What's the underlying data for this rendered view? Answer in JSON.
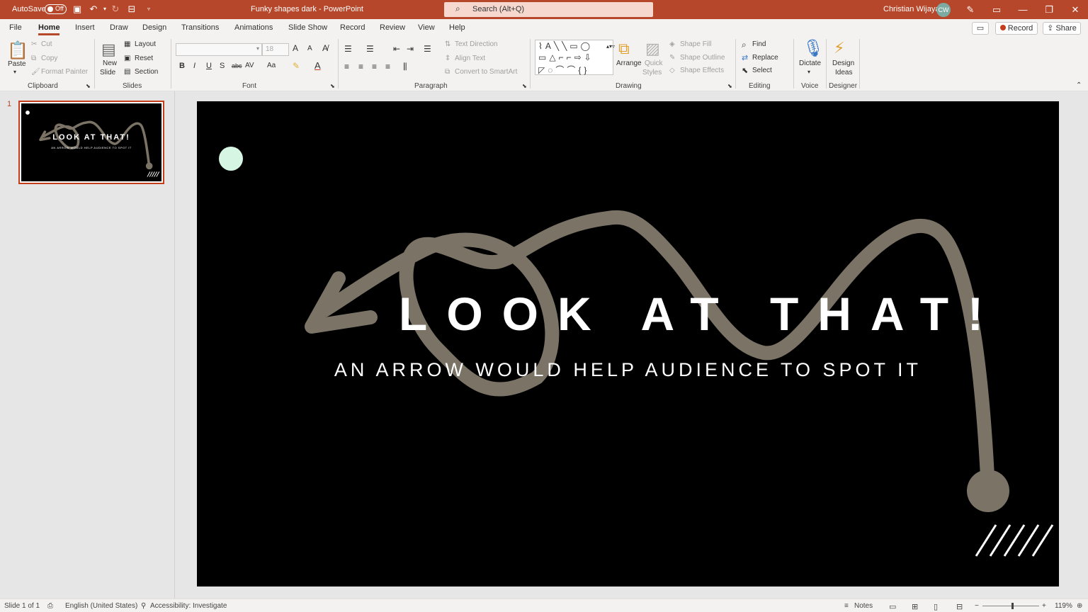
{
  "titlebar": {
    "autosave_label": "AutoSave",
    "autosave_state": "Off",
    "doc_title": "Funky shapes dark  -  PowerPoint",
    "search_placeholder": "Search (Alt+Q)",
    "user_name": "Christian Wijaya",
    "user_initials": "CW"
  },
  "menu": {
    "tabs": [
      "File",
      "Home",
      "Insert",
      "Draw",
      "Design",
      "Transitions",
      "Animations",
      "Slide Show",
      "Record",
      "Review",
      "View",
      "Help"
    ],
    "active_tab": "Home",
    "record_label": "Record",
    "share_label": "Share"
  },
  "ribbon": {
    "clipboard": {
      "paste": "Paste",
      "cut": "Cut",
      "copy": "Copy",
      "format_painter": "Format Painter",
      "label": "Clipboard"
    },
    "slides": {
      "new_slide_line1": "New",
      "new_slide_line2": "Slide",
      "layout": "Layout",
      "reset": "Reset",
      "section": "Section",
      "label": "Slides"
    },
    "font": {
      "size": "18",
      "bold": "B",
      "italic": "I",
      "underline": "U",
      "strike": "S",
      "shadow": "abc",
      "spacing": "AV",
      "case": "Aa",
      "grow": "A",
      "shrink": "A",
      "label": "Font"
    },
    "paragraph": {
      "text_direction": "Text Direction",
      "align_text": "Align Text",
      "convert_smartart": "Convert to SmartArt",
      "label": "Paragraph"
    },
    "drawing": {
      "arrange": "Arrange",
      "quick_styles_line1": "Quick",
      "quick_styles_line2": "Styles",
      "shape_fill": "Shape Fill",
      "shape_outline": "Shape Outline",
      "shape_effects": "Shape Effects",
      "label": "Drawing"
    },
    "editing": {
      "find": "Find",
      "replace": "Replace",
      "select": "Select",
      "label": "Editing"
    },
    "voice": {
      "dictate": "Dictate",
      "label": "Voice"
    },
    "designer": {
      "design_ideas_line1": "Design",
      "design_ideas_line2": "Ideas",
      "label": "Designer"
    }
  },
  "slides_panel": {
    "slide_number": "1",
    "thumb_title": "LOOK AT THAT!",
    "thumb_subtitle": "AN ARROW WOULD HELP AUDIENCE TO SPOT IT"
  },
  "slide": {
    "title": "LOOK AT THAT!",
    "subtitle": "AN ARROW WOULD HELP AUDIENCE TO SPOT IT",
    "colors": {
      "background": "#000000",
      "arrow": "#7a7366",
      "circle": "#d6f5e3",
      "text": "#ffffff"
    }
  },
  "statusbar": {
    "slide_info": "Slide 1 of 1",
    "language": "English (United States)",
    "accessibility": "Accessibility: Investigate",
    "notes": "Notes",
    "zoom": "119%"
  },
  "theme": {
    "accent": "#b7472a"
  }
}
